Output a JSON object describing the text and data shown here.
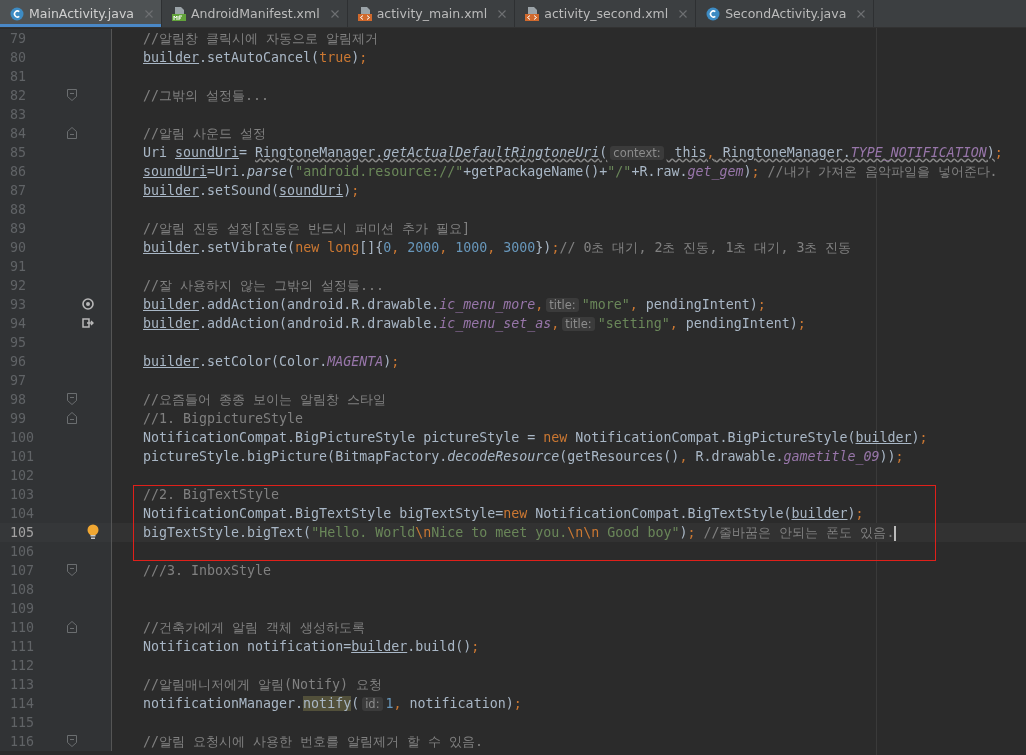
{
  "tabs": [
    {
      "label": "MainActivity.java",
      "kind": "class",
      "selected": true
    },
    {
      "label": "AndroidManifest.xml",
      "kind": "manifest",
      "selected": false
    },
    {
      "label": "activity_main.xml",
      "kind": "layout",
      "selected": false
    },
    {
      "label": "activity_second.xml",
      "kind": "layout",
      "selected": false
    },
    {
      "label": "SecondActivity.java",
      "kind": "class",
      "selected": false
    }
  ],
  "sections": [
    {
      "framed": false,
      "lines": [
        {
          "number": "79",
          "current": false,
          "tokens": [
            {
              "kind": "cmt",
              "text": "//알림창 클릭시에 자동으로 알림제거"
            }
          ]
        },
        {
          "number": "80",
          "current": false,
          "tokens": [
            {
              "kind": "var",
              "text": "builder"
            },
            {
              "kind": "plain",
              "text": ".setAutoCancel("
            },
            {
              "kind": "kw",
              "text": "true"
            },
            {
              "kind": "plain",
              "text": ")"
            },
            {
              "kind": "kw",
              "text": ";"
            }
          ]
        },
        {
          "number": "81",
          "current": false
        },
        {
          "number": "82",
          "current": false,
          "gutter": {
            "kind": "fold-end"
          },
          "tokens": [
            {
              "kind": "cmt",
              "text": "//그밖의 설정들..."
            }
          ]
        },
        {
          "number": "83",
          "current": false
        },
        {
          "number": "84",
          "current": false,
          "gutter": {
            "kind": "fold-start"
          },
          "tokens": [
            {
              "kind": "cmt",
              "text": "//알림 사운드 설정"
            }
          ]
        },
        {
          "number": "85",
          "current": false,
          "tokens": [
            {
              "kind": "plain",
              "text": "Uri "
            },
            {
              "kind": "var",
              "text": "soundUri"
            },
            {
              "kind": "plain",
              "text": "= "
            },
            {
              "kind": "warn",
              "text": "RingtoneManager."
            },
            {
              "kind": "warnstatic",
              "text": "getActualDefaultRingtoneUri"
            },
            {
              "kind": "warn",
              "text": "("
            },
            {
              "kind": "hint",
              "text": "context:"
            },
            {
              "kind": "warn",
              "text": " this"
            },
            {
              "kind": "warnkw",
              "text": ","
            },
            {
              "kind": "warn",
              "text": " RingtoneManager."
            },
            {
              "kind": "warnfield",
              "text": "TYPE_NOTIFICATION"
            },
            {
              "kind": "warn",
              "text": ")"
            },
            {
              "kind": "kw",
              "text": ";"
            }
          ]
        },
        {
          "number": "86",
          "current": false,
          "tokens": [
            {
              "kind": "var",
              "text": "soundUri"
            },
            {
              "kind": "plain",
              "text": "=Uri."
            },
            {
              "kind": "static",
              "text": "parse"
            },
            {
              "kind": "plain",
              "text": "("
            },
            {
              "kind": "str",
              "text": "\"android.resource://\""
            },
            {
              "kind": "plain",
              "text": "+getPackageName()+"
            },
            {
              "kind": "str",
              "text": "\"/\""
            },
            {
              "kind": "plain",
              "text": "+R.raw."
            },
            {
              "kind": "field",
              "text": "get_gem"
            },
            {
              "kind": "plain",
              "text": ")"
            },
            {
              "kind": "kw",
              "text": ";"
            },
            {
              "kind": "cmt",
              "text": " //내가 가져온 음악파일을 넣어준다."
            }
          ]
        },
        {
          "number": "87",
          "current": false,
          "tokens": [
            {
              "kind": "var",
              "text": "builder"
            },
            {
              "kind": "plain",
              "text": ".setSound("
            },
            {
              "kind": "var",
              "text": "soundUri"
            },
            {
              "kind": "plain",
              "text": ")"
            },
            {
              "kind": "kw",
              "text": ";"
            }
          ]
        },
        {
          "number": "88",
          "current": false
        },
        {
          "number": "89",
          "current": false,
          "tokens": [
            {
              "kind": "cmt",
              "text": "//알림 진동 설정[진동은 반드시 퍼미션 추가 필요]"
            }
          ]
        },
        {
          "number": "90",
          "current": false,
          "tokens": [
            {
              "kind": "var",
              "text": "builder"
            },
            {
              "kind": "plain",
              "text": ".setVibrate("
            },
            {
              "kind": "kw",
              "text": "new long"
            },
            {
              "kind": "plain",
              "text": "[]{"
            },
            {
              "kind": "num",
              "text": "0"
            },
            {
              "kind": "kw",
              "text": ","
            },
            {
              "kind": "num",
              "text": " 2000"
            },
            {
              "kind": "kw",
              "text": ","
            },
            {
              "kind": "num",
              "text": " 1000"
            },
            {
              "kind": "kw",
              "text": ","
            },
            {
              "kind": "num",
              "text": " 3000"
            },
            {
              "kind": "plain",
              "text": "})"
            },
            {
              "kind": "kw",
              "text": ";"
            },
            {
              "kind": "cmt",
              "text": "// 0초 대기, 2초 진동, 1초 대기, 3초 진동"
            }
          ]
        },
        {
          "number": "91",
          "current": false
        },
        {
          "number": "92",
          "current": false,
          "tokens": [
            {
              "kind": "cmt",
              "text": "//잘 사용하지 않는 그밖의 설정들..."
            }
          ]
        },
        {
          "number": "93",
          "current": false,
          "gutter": {
            "kind": "override"
          },
          "tokens": [
            {
              "kind": "var",
              "text": "builder"
            },
            {
              "kind": "plain",
              "text": ".addAction(android.R.drawable."
            },
            {
              "kind": "field",
              "text": "ic_menu_more"
            },
            {
              "kind": "kw",
              "text": ","
            },
            {
              "kind": "hint",
              "text": "title:"
            },
            {
              "kind": "str",
              "text": "\"more\""
            },
            {
              "kind": "kw",
              "text": ","
            },
            {
              "kind": "plain",
              "text": " pendingIntent)"
            },
            {
              "kind": "kw",
              "text": ";"
            }
          ]
        },
        {
          "number": "94",
          "current": false,
          "gutter": {
            "kind": "implement"
          },
          "tokens": [
            {
              "kind": "var",
              "text": "builder"
            },
            {
              "kind": "plain",
              "text": ".addAction(android.R.drawable."
            },
            {
              "kind": "field",
              "text": "ic_menu_set_as"
            },
            {
              "kind": "kw",
              "text": ","
            },
            {
              "kind": "hint",
              "text": "title:"
            },
            {
              "kind": "str",
              "text": "\"setting\""
            },
            {
              "kind": "kw",
              "text": ","
            },
            {
              "kind": "plain",
              "text": " pendingIntent)"
            },
            {
              "kind": "kw",
              "text": ";"
            }
          ]
        },
        {
          "number": "95",
          "current": false
        },
        {
          "number": "96",
          "current": false,
          "tokens": [
            {
              "kind": "var",
              "text": "builder"
            },
            {
              "kind": "plain",
              "text": ".setColor(Color."
            },
            {
              "kind": "field",
              "text": "MAGENTA"
            },
            {
              "kind": "plain",
              "text": ")"
            },
            {
              "kind": "kw",
              "text": ";"
            }
          ]
        },
        {
          "number": "97",
          "current": false
        },
        {
          "number": "98",
          "current": false,
          "gutter": {
            "kind": "fold-end"
          },
          "tokens": [
            {
              "kind": "cmt",
              "text": "//요즘들어 종종 보이는 알림창 스타일"
            }
          ]
        },
        {
          "number": "99",
          "current": false,
          "gutter": {
            "kind": "fold-start"
          },
          "tokens": [
            {
              "kind": "cmt",
              "text": "//1. BigpictureStyle"
            }
          ]
        },
        {
          "number": "100",
          "current": false,
          "tokens": [
            {
              "kind": "plain",
              "text": "NotificationCompat.BigPictureStyle pictureStyle = "
            },
            {
              "kind": "kw",
              "text": "new"
            },
            {
              "kind": "plain",
              "text": " NotificationCompat.BigPictureStyle("
            },
            {
              "kind": "var",
              "text": "builder"
            },
            {
              "kind": "plain",
              "text": ")"
            },
            {
              "kind": "kw",
              "text": ";"
            }
          ]
        },
        {
          "number": "101",
          "current": false,
          "tokens": [
            {
              "kind": "plain",
              "text": "pictureStyle.bigPicture(BitmapFactory."
            },
            {
              "kind": "static",
              "text": "decodeResource"
            },
            {
              "kind": "plain",
              "text": "(getResources()"
            },
            {
              "kind": "kw",
              "text": ","
            },
            {
              "kind": "plain",
              "text": " R.drawable."
            },
            {
              "kind": "field",
              "text": "gametitle_09"
            },
            {
              "kind": "plain",
              "text": "))"
            },
            {
              "kind": "kw",
              "text": ";"
            }
          ]
        },
        {
          "number": "102",
          "current": false
        }
      ]
    },
    {
      "framed": true,
      "lines": [
        {
          "number": "103",
          "current": false,
          "tokens": [
            {
              "kind": "cmt",
              "text": "//2. BigTextStyle"
            }
          ]
        },
        {
          "number": "104",
          "current": false,
          "tokens": [
            {
              "kind": "plain",
              "text": "NotificationCompat.BigTextStyle bigTextStyle="
            },
            {
              "kind": "kw",
              "text": "new"
            },
            {
              "kind": "plain",
              "text": " NotificationCompat.BigTextStyle("
            },
            {
              "kind": "var",
              "text": "builder"
            },
            {
              "kind": "plain",
              "text": ")"
            },
            {
              "kind": "kw",
              "text": ";"
            }
          ]
        },
        {
          "number": "105",
          "current": true,
          "gutter": {
            "kind": "bulb"
          },
          "tokens": [
            {
              "kind": "plain",
              "text": "bigTextStyle.bigText("
            },
            {
              "kind": "str",
              "text": "\"Hello. World"
            },
            {
              "kind": "kw",
              "text": "\\n"
            },
            {
              "kind": "str",
              "text": "Nice to meet you."
            },
            {
              "kind": "kw",
              "text": "\\n\\n"
            },
            {
              "kind": "str",
              "text": " Good boy\""
            },
            {
              "kind": "plain",
              "text": ")"
            },
            {
              "kind": "kw",
              "text": ";"
            },
            {
              "kind": "cmt",
              "text": " //줄바꿈은 안되는 폰도 있음."
            }
          ]
        },
        {
          "number": "106",
          "current": false
        }
      ]
    },
    {
      "framed": false,
      "lines": [
        {
          "number": "107",
          "current": false,
          "gutter": {
            "kind": "fold-end"
          },
          "tokens": [
            {
              "kind": "cmt",
              "text": "///3. InboxStyle"
            }
          ]
        },
        {
          "number": "108",
          "current": false
        },
        {
          "number": "109",
          "current": false
        },
        {
          "number": "110",
          "current": false,
          "gutter": {
            "kind": "fold-start"
          },
          "tokens": [
            {
              "kind": "cmt",
              "text": "//건축가에게 알림 객체 생성하도록"
            }
          ]
        },
        {
          "number": "111",
          "current": false,
          "tokens": [
            {
              "kind": "plain",
              "text": "Notification notification="
            },
            {
              "kind": "var",
              "text": "builder"
            },
            {
              "kind": "plain",
              "text": ".build()"
            },
            {
              "kind": "kw",
              "text": ";"
            }
          ]
        },
        {
          "number": "112",
          "current": false
        },
        {
          "number": "113",
          "current": false,
          "tokens": [
            {
              "kind": "cmt",
              "text": "//알림매니저에게 알림(Notify) 요청"
            }
          ]
        },
        {
          "number": "114",
          "current": false,
          "tokens": [
            {
              "kind": "plain",
              "text": "notificationManager."
            },
            {
              "kind": "mark",
              "text": "notify"
            },
            {
              "kind": "plain",
              "text": "("
            },
            {
              "kind": "hint",
              "text": "id:"
            },
            {
              "kind": "num",
              "text": "1"
            },
            {
              "kind": "kw",
              "text": ","
            },
            {
              "kind": "plain",
              "text": " notification)"
            },
            {
              "kind": "kw",
              "text": ";"
            }
          ]
        },
        {
          "number": "115",
          "current": false
        },
        {
          "number": "116",
          "current": false,
          "gutter": {
            "kind": "fold-end"
          },
          "tokens": [
            {
              "kind": "cmt",
              "text": "//알림 요청시에 사용한 번호를 알림제거 할 수 있음."
            }
          ]
        }
      ]
    }
  ]
}
